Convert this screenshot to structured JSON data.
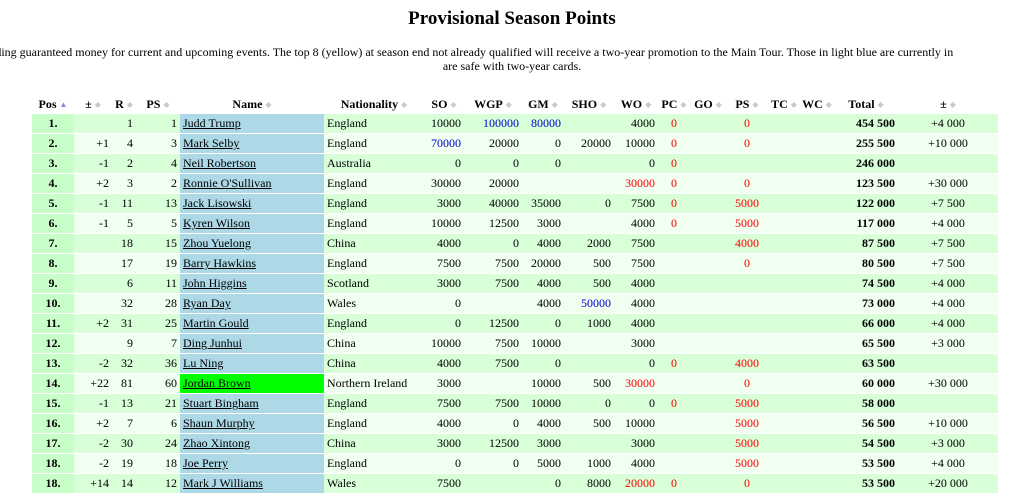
{
  "title": "Provisional Season Points",
  "intro": {
    "line1": "luding guaranteed money for current and upcoming events. The top 8 (yellow) at season end not already qualified will receive a two-year promotion to the Main Tour. Those in light blue are currently in",
    "line2": "are safe with two-year cards."
  },
  "icons": {
    "sort": "sort-arrows-icon",
    "sort_active": "sort-ascending-icon"
  },
  "colors": {
    "pos_bg": "#c8ffc8",
    "player_bg": "#add8e6",
    "player_highlight": "#00ff00",
    "row_odd": "#d8ffd8",
    "row_even": "#f0fff0",
    "blue_value": "#0000cc",
    "red_value": "#ff0000"
  },
  "columns": [
    "Pos",
    "±",
    "R",
    "PS",
    "Name",
    "Nationality",
    "SO",
    "WGP",
    "GM",
    "SHO",
    "WO",
    "PC",
    "GO",
    "PS",
    "TC",
    "WC",
    "Total",
    "±"
  ],
  "rows": [
    {
      "pos": "1.",
      "chg": "",
      "r": "1",
      "ps": "1",
      "name": "Judd Trump",
      "nat": "England",
      "so": "10000",
      "wgp": "100000",
      "gm": "80000",
      "sho": "",
      "wo": "4000",
      "pc": "0",
      "go": "",
      "ps2": "0",
      "tc": "",
      "wc": "",
      "total": "454 500",
      "diff": "+4 000"
    },
    {
      "pos": "2.",
      "chg": "+1",
      "r": "4",
      "ps": "3",
      "name": "Mark Selby",
      "nat": "England",
      "so": "70000",
      "wgp": "20000",
      "gm": "0",
      "sho": "20000",
      "wo": "10000",
      "pc": "0",
      "go": "",
      "ps2": "0",
      "tc": "",
      "wc": "",
      "total": "255 500",
      "diff": "+10 000"
    },
    {
      "pos": "3.",
      "chg": "-1",
      "r": "2",
      "ps": "4",
      "name": "Neil Robertson",
      "nat": "Australia",
      "so": "0",
      "wgp": "0",
      "gm": "0",
      "sho": "",
      "wo": "0",
      "pc": "0",
      "go": "",
      "ps2": "",
      "tc": "",
      "wc": "",
      "total": "246 000",
      "diff": ""
    },
    {
      "pos": "4.",
      "chg": "+2",
      "r": "3",
      "ps": "2",
      "name": "Ronnie O'Sullivan",
      "nat": "England",
      "so": "30000",
      "wgp": "20000",
      "gm": "",
      "sho": "",
      "wo": "30000",
      "pc": "0",
      "go": "",
      "ps2": "0",
      "tc": "",
      "wc": "",
      "total": "123 500",
      "diff": "+30 000"
    },
    {
      "pos": "5.",
      "chg": "-1",
      "r": "11",
      "ps": "13",
      "name": "Jack Lisowski",
      "nat": "England",
      "so": "3000",
      "wgp": "40000",
      "gm": "35000",
      "sho": "0",
      "wo": "7500",
      "pc": "0",
      "go": "",
      "ps2": "5000",
      "tc": "",
      "wc": "",
      "total": "122 000",
      "diff": "+7 500"
    },
    {
      "pos": "6.",
      "chg": "-1",
      "r": "5",
      "ps": "5",
      "name": "Kyren Wilson",
      "nat": "England",
      "so": "10000",
      "wgp": "12500",
      "gm": "3000",
      "sho": "",
      "wo": "4000",
      "pc": "0",
      "go": "",
      "ps2": "5000",
      "tc": "",
      "wc": "",
      "total": "117 000",
      "diff": "+4 000"
    },
    {
      "pos": "7.",
      "chg": "",
      "r": "18",
      "ps": "15",
      "name": "Zhou Yuelong",
      "nat": "China",
      "so": "4000",
      "wgp": "0",
      "gm": "4000",
      "sho": "2000",
      "wo": "7500",
      "pc": "",
      "go": "",
      "ps2": "4000",
      "tc": "",
      "wc": "",
      "total": "87 500",
      "diff": "+7 500"
    },
    {
      "pos": "8.",
      "chg": "",
      "r": "17",
      "ps": "19",
      "name": "Barry Hawkins",
      "nat": "England",
      "so": "7500",
      "wgp": "7500",
      "gm": "20000",
      "sho": "500",
      "wo": "7500",
      "pc": "",
      "go": "",
      "ps2": "0",
      "tc": "",
      "wc": "",
      "total": "80 500",
      "diff": "+7 500"
    },
    {
      "pos": "9.",
      "chg": "",
      "r": "6",
      "ps": "11",
      "name": "John Higgins",
      "nat": "Scotland",
      "so": "3000",
      "wgp": "7500",
      "gm": "4000",
      "sho": "500",
      "wo": "4000",
      "pc": "",
      "go": "",
      "ps2": "",
      "tc": "",
      "wc": "",
      "total": "74 500",
      "diff": "+4 000"
    },
    {
      "pos": "10.",
      "chg": "",
      "r": "32",
      "ps": "28",
      "name": "Ryan Day",
      "nat": "Wales",
      "so": "0",
      "wgp": "",
      "gm": "4000",
      "sho": "50000",
      "wo": "4000",
      "pc": "",
      "go": "",
      "ps2": "",
      "tc": "",
      "wc": "",
      "total": "73 000",
      "diff": "+4 000"
    },
    {
      "pos": "11.",
      "chg": "+2",
      "r": "31",
      "ps": "25",
      "name": "Martin Gould",
      "nat": "England",
      "so": "0",
      "wgp": "12500",
      "gm": "0",
      "sho": "1000",
      "wo": "4000",
      "pc": "",
      "go": "",
      "ps2": "",
      "tc": "",
      "wc": "",
      "total": "66 000",
      "diff": "+4 000"
    },
    {
      "pos": "12.",
      "chg": "",
      "r": "9",
      "ps": "7",
      "name": "Ding Junhui",
      "nat": "China",
      "so": "10000",
      "wgp": "7500",
      "gm": "10000",
      "sho": "",
      "wo": "3000",
      "pc": "",
      "go": "",
      "ps2": "",
      "tc": "",
      "wc": "",
      "total": "65 500",
      "diff": "+3 000"
    },
    {
      "pos": "13.",
      "chg": "-2",
      "r": "32",
      "ps": "36",
      "name": "Lu Ning",
      "nat": "China",
      "so": "4000",
      "wgp": "7500",
      "gm": "0",
      "sho": "",
      "wo": "0",
      "pc": "0",
      "go": "",
      "ps2": "4000",
      "tc": "",
      "wc": "",
      "total": "63 500",
      "diff": ""
    },
    {
      "pos": "14.",
      "chg": "+22",
      "r": "81",
      "ps": "60",
      "name": "Jordan Brown",
      "nat": "Northern Ireland",
      "so": "3000",
      "wgp": "",
      "gm": "10000",
      "sho": "500",
      "wo": "30000",
      "pc": "",
      "go": "",
      "ps2": "0",
      "tc": "",
      "wc": "",
      "total": "60 000",
      "diff": "+30 000"
    },
    {
      "pos": "15.",
      "chg": "-1",
      "r": "13",
      "ps": "21",
      "name": "Stuart Bingham",
      "nat": "England",
      "so": "7500",
      "wgp": "7500",
      "gm": "10000",
      "sho": "0",
      "wo": "0",
      "pc": "0",
      "go": "",
      "ps2": "5000",
      "tc": "",
      "wc": "",
      "total": "58 000",
      "diff": ""
    },
    {
      "pos": "16.",
      "chg": "+2",
      "r": "7",
      "ps": "6",
      "name": "Shaun Murphy",
      "nat": "England",
      "so": "4000",
      "wgp": "0",
      "gm": "4000",
      "sho": "500",
      "wo": "10000",
      "pc": "",
      "go": "",
      "ps2": "5000",
      "tc": "",
      "wc": "",
      "total": "56 500",
      "diff": "+10 000"
    },
    {
      "pos": "17.",
      "chg": "-2",
      "r": "30",
      "ps": "24",
      "name": "Zhao Xintong",
      "nat": "China",
      "so": "3000",
      "wgp": "12500",
      "gm": "3000",
      "sho": "",
      "wo": "3000",
      "pc": "",
      "go": "",
      "ps2": "5000",
      "tc": "",
      "wc": "",
      "total": "54 500",
      "diff": "+3 000"
    },
    {
      "pos": "18.",
      "chg": "-2",
      "r": "19",
      "ps": "18",
      "name": "Joe Perry",
      "nat": "England",
      "so": "0",
      "wgp": "0",
      "gm": "5000",
      "sho": "1000",
      "wo": "4000",
      "pc": "",
      "go": "",
      "ps2": "5000",
      "tc": "",
      "wc": "",
      "total": "53 500",
      "diff": "+4 000"
    },
    {
      "pos": "18.",
      "chg": "+14",
      "r": "14",
      "ps": "12",
      "name": "Mark J Williams",
      "nat": "Wales",
      "so": "7500",
      "wgp": "",
      "gm": "0",
      "sho": "8000",
      "wo": "20000",
      "pc": "0",
      "go": "",
      "ps2": "0",
      "tc": "",
      "wc": "",
      "total": "53 500",
      "diff": "+20 000"
    }
  ]
}
